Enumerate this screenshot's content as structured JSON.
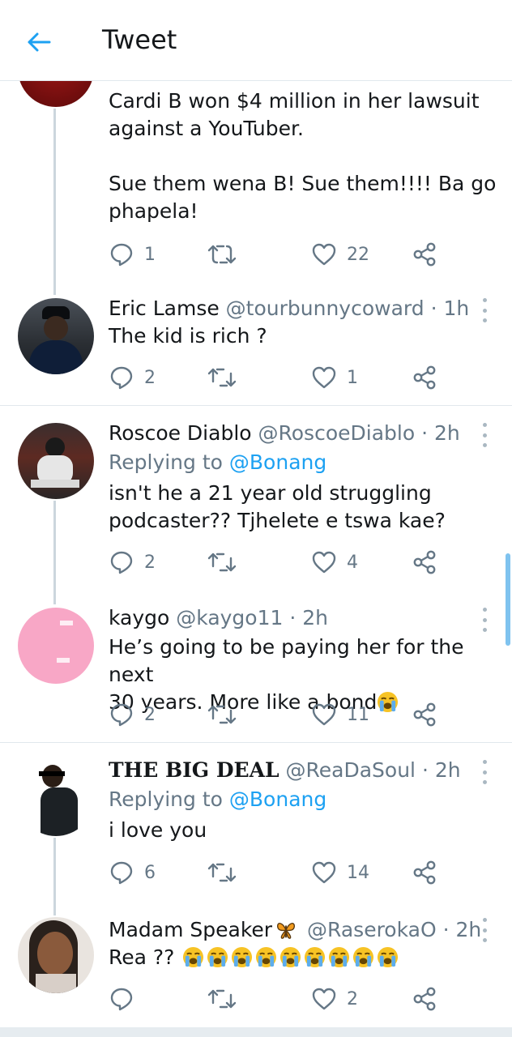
{
  "header": {
    "title": "Tweet"
  },
  "tweets": [
    {
      "body_lines": [
        "Cardi B won $4 million in her lawsuit",
        "against a YouTuber.",
        "",
        "Sue them wena B! Sue them!!!! Ba go",
        "phapela!"
      ],
      "replies": "1",
      "retweets": "",
      "likes": "22"
    },
    {
      "name": "Eric Lamse",
      "handle": "@tourbunnycoward",
      "time": "1h",
      "text": "The kid is rich ?",
      "replies": "2",
      "retweets": "",
      "likes": "1"
    },
    {
      "name": "Roscoe Diablo",
      "handle": "@RoscoeDiablo",
      "time": "2h",
      "replying_prefix": "Replying to",
      "replying_handle": "@Bonang",
      "body_lines": [
        "isn't he a 21 year old struggling",
        "podcaster?? Tjhelete e tswa kae?"
      ],
      "replies": "2",
      "retweets": "",
      "likes": "4"
    },
    {
      "name": "kaygo",
      "handle": "@kaygo11",
      "time": "2h",
      "body_lines": [
        "He’s going to be paying her for the next",
        "30 years. More like a bond"
      ],
      "replies": "2",
      "retweets": "",
      "likes": "11"
    },
    {
      "name": "THE BIG DEAL",
      "handle": "@ReaDaSoul",
      "time": "2h",
      "replying_prefix": "Replying to",
      "replying_handle": "@Bonang",
      "text": "i love you",
      "replies": "6",
      "retweets": "",
      "likes": "14"
    },
    {
      "name": "Madam Speaker",
      "handle": "@RaserokaO",
      "time": "2h",
      "text": "Rea ??",
      "replies": "",
      "retweets": "",
      "likes": "2"
    }
  ],
  "icons": {
    "back": "arrow-left-icon",
    "reply": "speech-bubble-icon",
    "retweet": "retweet-icon",
    "like": "heart-icon",
    "share": "share-icon",
    "more": "more-vertical-icon",
    "crying": "loudly-crying-face-emoji",
    "butterfly": "butterfly-emoji"
  },
  "colors": {
    "accent": "#1da1f2",
    "text": "#14171a",
    "secondary": "#657786",
    "icon": "#657786"
  }
}
